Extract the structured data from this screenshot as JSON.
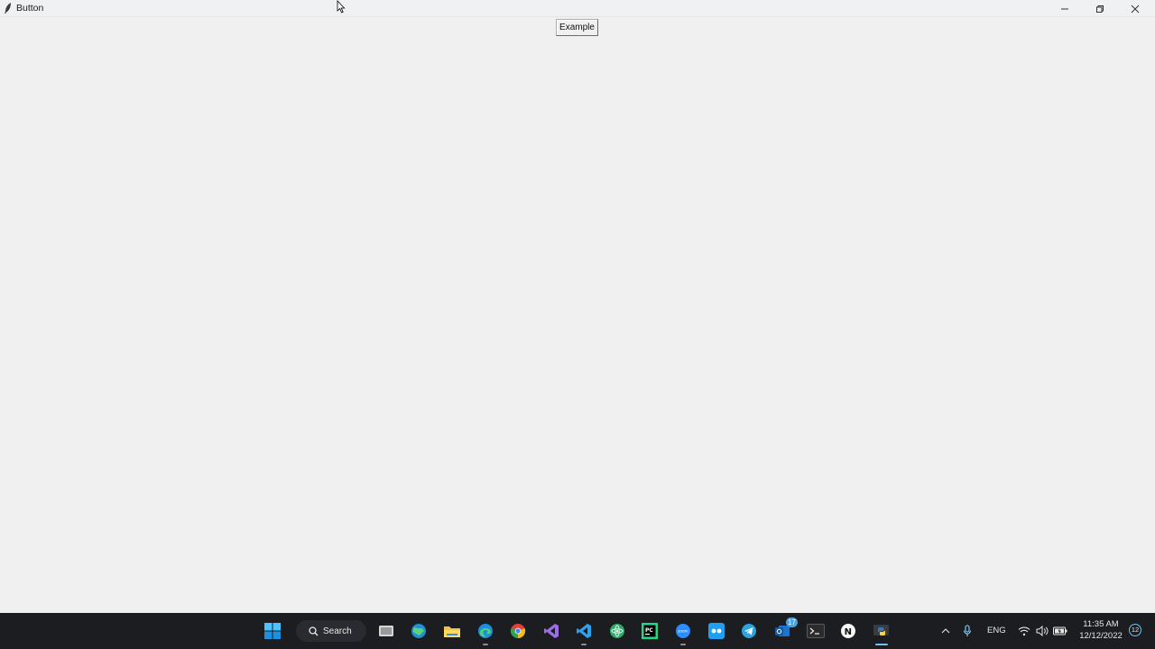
{
  "window": {
    "title": "Button",
    "controls": [
      "minimize-icon",
      "restore-icon",
      "close-icon"
    ]
  },
  "client": {
    "button_label": "Example"
  },
  "taskbar": {
    "search_label": "Search",
    "apps": [
      {
        "name": "start-icon"
      },
      {
        "name": "task-view-icon"
      },
      {
        "name": "browser-globe-icon"
      },
      {
        "name": "file-explorer-icon"
      },
      {
        "name": "edge-icon"
      },
      {
        "name": "chrome-icon"
      },
      {
        "name": "visual-studio-icon"
      },
      {
        "name": "vscode-icon"
      },
      {
        "name": "atom-icon"
      },
      {
        "name": "pycharm-icon",
        "text": "PC"
      },
      {
        "name": "zoom-icon",
        "text": "zoom"
      },
      {
        "name": "meet-icon"
      },
      {
        "name": "telegram-icon"
      },
      {
        "name": "outlook-icon",
        "badge": "17"
      },
      {
        "name": "terminal-icon"
      },
      {
        "name": "notion-icon",
        "text": "N"
      },
      {
        "name": "python-icon"
      }
    ],
    "tray": {
      "language": "ENG",
      "time": "11:35 AM",
      "date": "12/12/2022",
      "notification_count": "12"
    }
  },
  "colors": {
    "taskbar_bg": "#1c1d21",
    "window_bg": "#f0f0f0",
    "accent": "#6cc3f0"
  }
}
